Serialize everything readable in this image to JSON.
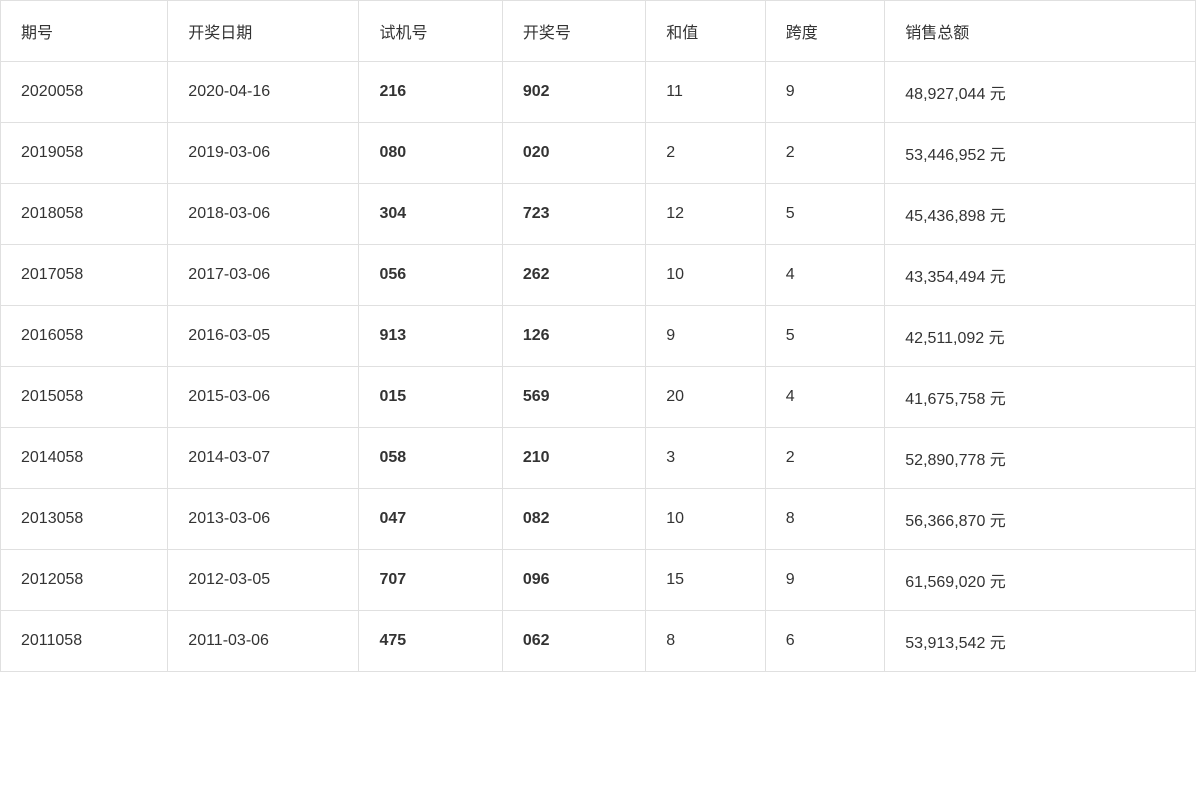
{
  "table": {
    "headers": [
      "期号",
      "开奖日期",
      "试机号",
      "开奖号",
      "和值",
      "跨度",
      "销售总额"
    ],
    "rows": [
      {
        "qihao": "2020058",
        "kaijangriqi": "2020-04-16",
        "shijihao": "216",
        "kaijanghao": "902",
        "hezhi": "11",
        "kuadu": "9",
        "xiaoshou": "48,927,044 元"
      },
      {
        "qihao": "2019058",
        "kaijangriqi": "2019-03-06",
        "shijihao": "080",
        "kaijanghao": "020",
        "hezhi": "2",
        "kuadu": "2",
        "xiaoshou": "53,446,952 元"
      },
      {
        "qihao": "2018058",
        "kaijangriqi": "2018-03-06",
        "shijihao": "304",
        "kaijanghao": "723",
        "hezhi": "12",
        "kuadu": "5",
        "xiaoshou": "45,436,898 元"
      },
      {
        "qihao": "2017058",
        "kaijangriqi": "2017-03-06",
        "shijihao": "056",
        "kaijanghao": "262",
        "hezhi": "10",
        "kuadu": "4",
        "xiaoshou": "43,354,494 元"
      },
      {
        "qihao": "2016058",
        "kaijangriqi": "2016-03-05",
        "shijihao": "913",
        "kaijanghao": "126",
        "hezhi": "9",
        "kuadu": "5",
        "xiaoshou": "42,511,092 元"
      },
      {
        "qihao": "2015058",
        "kaijangriqi": "2015-03-06",
        "shijihao": "015",
        "kaijanghao": "569",
        "hezhi": "20",
        "kuadu": "4",
        "xiaoshou": "41,675,758 元"
      },
      {
        "qihao": "2014058",
        "kaijangriqi": "2014-03-07",
        "shijihao": "058",
        "kaijanghao": "210",
        "hezhi": "3",
        "kuadu": "2",
        "xiaoshou": "52,890,778 元"
      },
      {
        "qihao": "2013058",
        "kaijangriqi": "2013-03-06",
        "shijihao": "047",
        "kaijanghao": "082",
        "hezhi": "10",
        "kuadu": "8",
        "xiaoshou": "56,366,870 元"
      },
      {
        "qihao": "2012058",
        "kaijangriqi": "2012-03-05",
        "shijihao": "707",
        "kaijanghao": "096",
        "hezhi": "15",
        "kuadu": "9",
        "xiaoshou": "61,569,020 元"
      },
      {
        "qihao": "2011058",
        "kaijangriqi": "2011-03-06",
        "shijihao": "475",
        "kaijanghao": "062",
        "hezhi": "8",
        "kuadu": "6",
        "xiaoshou": "53,913,542 元"
      }
    ]
  }
}
